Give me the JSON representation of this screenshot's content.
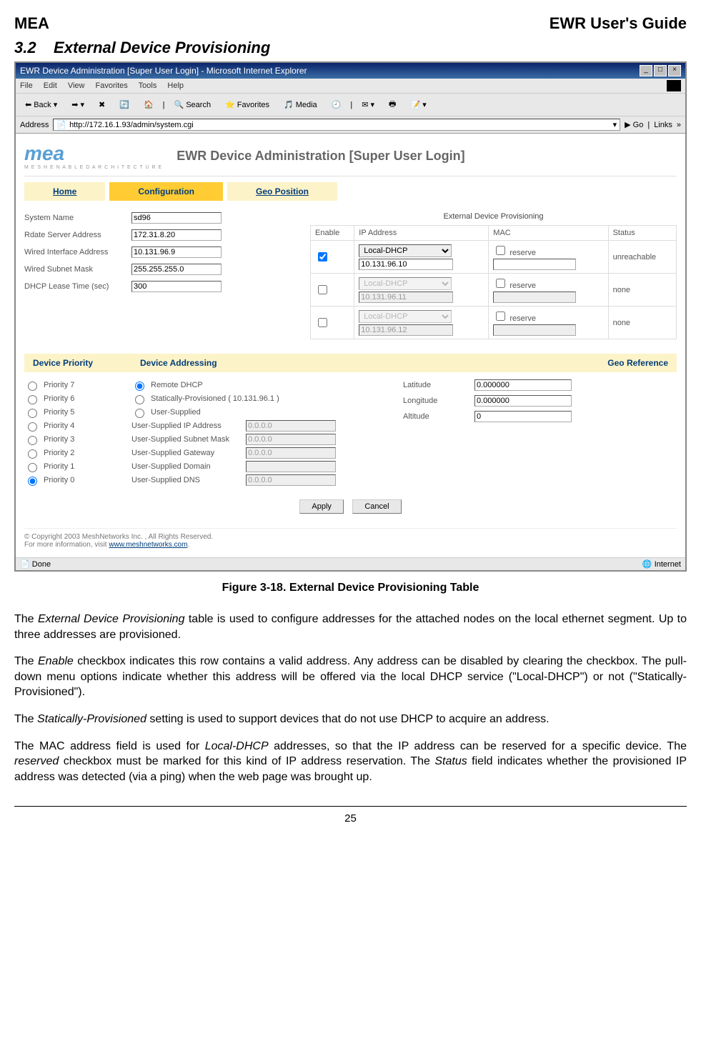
{
  "doc": {
    "left_header": "MEA",
    "right_header": "EWR User's Guide",
    "section_no": "3.2",
    "section_title": "External Device Provisioning",
    "caption": "Figure 3-18.   External Device Provisioning Table",
    "para1_a": "The ",
    "para1_i": "External Device Provisioning",
    "para1_b": " table is used to configure addresses for the attached nodes on the local ethernet segment.  Up to three addresses are provisioned.",
    "para2_a": "The ",
    "para2_i": "Enable",
    "para2_b": " checkbox indicates this row contains a valid address.  Any address can be disabled by clearing the checkbox.  The pull-down menu options indicate whether this address will be offered via the local DHCP service (\"Local-DHCP\") or not (\"Statically-Provisioned\").",
    "para3_a": "The ",
    "para3_i": "Statically-Provisioned",
    "para3_b": " setting is used to support devices that do not use DHCP to acquire an address.",
    "para4_a": "The MAC address field is used for ",
    "para4_i1": "Local-DHCP",
    "para4_b": " addresses, so that the IP address can be reserved for a specific device.  The ",
    "para4_i2": "reserved",
    "para4_c": " checkbox must be marked for this kind of IP address reservation.  The ",
    "para4_i3": "Status",
    "para4_d": " field indicates whether the provisioned IP address was detected (via a ping) when the web page was brought up.",
    "page_number": "25"
  },
  "browser": {
    "title": "EWR Device Administration [Super User Login] - Microsoft Internet Explorer",
    "menu": {
      "file": "File",
      "edit": "Edit",
      "view": "View",
      "favorites": "Favorites",
      "tools": "Tools",
      "help": "Help"
    },
    "toolbar": {
      "back": "Back",
      "search": "Search",
      "favorites": "Favorites",
      "media": "Media"
    },
    "address_label": "Address",
    "address_url": "http://172.16.1.93/admin/system.cgi",
    "go": "Go",
    "links": "Links",
    "status_done": "Done",
    "status_zone": "Internet"
  },
  "page": {
    "logo": "mea",
    "logo_sub": "M E S H   E N A B L E D   A R C H I T E C T U R E",
    "heading": "EWR Device Administration [Super User Login]",
    "nav": {
      "home": "Home",
      "config": "Configuration",
      "geo": "Geo Position"
    }
  },
  "fields": {
    "system_name_label": "System Name",
    "system_name": "sd96",
    "rdate_label": "Rdate Server Address",
    "rdate": "172.31.8.20",
    "wired_iface_label": "Wired Interface Address",
    "wired_iface": "10.131.96.9",
    "wired_mask_label": "Wired Subnet Mask",
    "wired_mask": "255.255.255.0",
    "dhcp_lease_label": "DHCP Lease Time (sec)",
    "dhcp_lease": "300"
  },
  "ext": {
    "title": "External Device Provisioning",
    "cols": {
      "enable": "Enable",
      "ip": "IP Address",
      "mac": "MAC",
      "status": "Status"
    },
    "opt": "Local-DHCP",
    "reserve": "reserve",
    "rows": [
      {
        "enabled": true,
        "ip": "10.131.96.10",
        "status": "unreachable"
      },
      {
        "enabled": false,
        "ip": "10.131.96.11",
        "status": "none"
      },
      {
        "enabled": false,
        "ip": "10.131.96.12",
        "status": "none"
      }
    ]
  },
  "priority": {
    "head": "Device Priority",
    "items": [
      "Priority 7",
      "Priority 6",
      "Priority 5",
      "Priority 4",
      "Priority 3",
      "Priority 2",
      "Priority 1",
      "Priority 0"
    ]
  },
  "addressing": {
    "head": "Device Addressing",
    "remote": "Remote DHCP",
    "static": "Statically-Provisioned ( 10.131.96.1 )",
    "user": "User-Supplied",
    "us_ip_label": "User-Supplied IP Address",
    "us_ip": "0.0.0.0",
    "us_mask_label": "User-Supplied Subnet Mask",
    "us_mask": "0.0.0.0",
    "us_gw_label": "User-Supplied Gateway",
    "us_gw": "0.0.0.0",
    "us_domain_label": "User-Supplied Domain",
    "us_domain": "",
    "us_dns_label": "User-Supplied DNS",
    "us_dns": "0.0.0.0"
  },
  "geo": {
    "head": "Geo Reference",
    "lat_label": "Latitude",
    "lat": "0.000000",
    "lon_label": "Longitude",
    "lon": "0.000000",
    "alt_label": "Altitude",
    "alt": "0"
  },
  "buttons": {
    "apply": "Apply",
    "cancel": "Cancel"
  },
  "footer": {
    "copy": "© Copyright 2003 MeshNetworks Inc. , All Rights Reserved.",
    "visit_pre": "For more information, visit ",
    "link": "www.meshnetworks.com"
  }
}
